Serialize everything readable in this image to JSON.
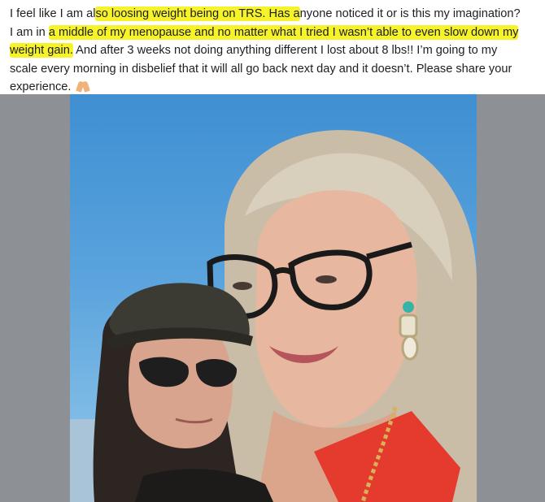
{
  "post": {
    "lines": [
      {
        "before": "I feel like I am al",
        "highlight": "so loosing weight being on TRS. Has a",
        "after": "nyone noticed it or is this my imagination?"
      },
      {
        "before": "I am in ",
        "highlight": "a middle of my menopause and no matter what I tried I wasn’t able to even slow down my",
        "after": ""
      },
      {
        "before": "",
        "highlight": "weight gain.",
        "after": " And after 3 weeks not doing anything different I lost about 8 lbs!! I’m going to my"
      },
      {
        "before": "scale every morning in disbelief that it will all go back next day and it doesn’t. Please share your",
        "highlight": "",
        "after": ""
      },
      {
        "before": "experience.",
        "highlight": "",
        "after": ""
      }
    ],
    "emoji_icon": "folded-hands-icon"
  },
  "photo": {
    "icon": "selfie-photo",
    "colors": {
      "sky": "#5aa3dd",
      "frame": "#8d9195",
      "highlight": "#f7f32a",
      "top": "#e53b2e"
    }
  }
}
